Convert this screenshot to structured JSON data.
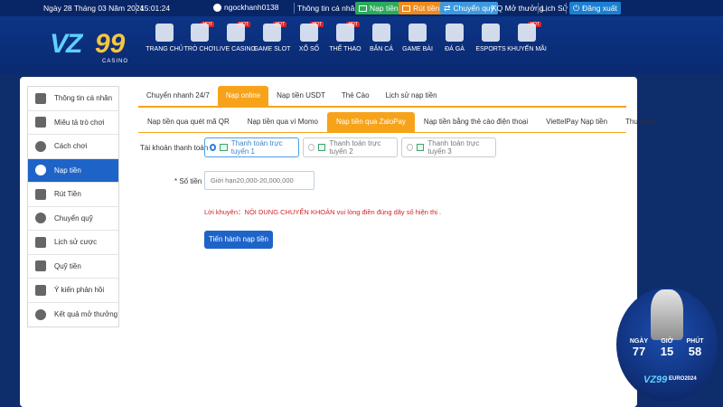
{
  "topbar": {
    "date": "Ngày 28 Tháng 03 Năm 2024",
    "time": "15:01:24",
    "username": "ngockhanh0138",
    "profile": "Thông tin cá nhân",
    "deposit": "Nạp tiền",
    "withdraw": "Rút tiền",
    "transfer": "Chuyển quỹ",
    "lottery": "KQ Mở thưởng",
    "history": "Lịch Sử",
    "logout": "Đăng xuất"
  },
  "logo": {
    "vz": "VZ",
    "num": "99",
    "sub": "CASINO"
  },
  "nav": [
    {
      "label": "TRANG CHỦ",
      "hot": ""
    },
    {
      "label": "TRÒ CHƠI",
      "hot": "HOT"
    },
    {
      "label": "LIVE CASINO",
      "hot": "HOT"
    },
    {
      "label": "GAME SLOT",
      "hot": "HOT"
    },
    {
      "label": "XỔ SỐ",
      "hot": "HOT"
    },
    {
      "label": "THỂ THAO",
      "hot": "HOT"
    },
    {
      "label": "BẮN CÁ",
      "hot": ""
    },
    {
      "label": "GAME BÀI",
      "hot": ""
    },
    {
      "label": "ĐÁ GÀ",
      "hot": ""
    },
    {
      "label": "ESPORTS",
      "hot": ""
    },
    {
      "label": "KHUYẾN MÃI",
      "hot": "HOT"
    }
  ],
  "sidebar": [
    {
      "label": "Thông tin cá nhân",
      "icon": "profile-card-icon"
    },
    {
      "label": "Miêu tả trò chơi",
      "icon": "gamepad-icon"
    },
    {
      "label": "Cách chơi",
      "icon": "info-icon"
    },
    {
      "label": "Nạp tiền",
      "icon": "piggy-bank-icon"
    },
    {
      "label": "Rút Tiền",
      "icon": "withdraw-icon"
    },
    {
      "label": "Chuyển quỹ",
      "icon": "currency-icon"
    },
    {
      "label": "Lịch sử cược",
      "icon": "history-list-icon"
    },
    {
      "label": "Quỹ tiền",
      "icon": "wallet-icon"
    },
    {
      "label": "Ý kiến phản hồi",
      "icon": "feedback-icon"
    },
    {
      "label": "Kết quả mở thưởng",
      "icon": "result-clock-icon"
    }
  ],
  "tabs_main": [
    "Chuyển nhanh 24/7",
    "Nạp online",
    "Nạp tiền USDT",
    "Thẻ Cào",
    "Lịch sử nạp tiền"
  ],
  "tabs_sub": [
    "Nạp tiền qua quét mã QR",
    "Nạp tiền qua ví Momo",
    "Nạp tiền qua ZaloPay",
    "Nạp tiền bằng thẻ cào điện thoại",
    "ViettelPay Nạp tiền",
    "Thu ngân"
  ],
  "form": {
    "account_label": "Tài khoản thanh toán",
    "options": [
      "Thanh toán trực tuyến 1",
      "Thanh toán trực tuyến 2",
      "Thanh toán trực tuyến 3"
    ],
    "amount_label": "* Số tiền",
    "amount_placeholder": "Giới hạn20,000-20,000,000",
    "warning": "Lời khuyên：NỘI DUNG CHUYỂN KHOẢN vui lòng điền đúng dãy số hiện thị .",
    "submit": "Tiến hành nạp tiền"
  },
  "countdown": {
    "days_label": "NGÀY",
    "days": "77",
    "hours_label": "GIỜ",
    "hours": "15",
    "minutes_label": "PHÚT",
    "minutes": "58",
    "brand": "VZ99",
    "event": "EURO2024"
  }
}
